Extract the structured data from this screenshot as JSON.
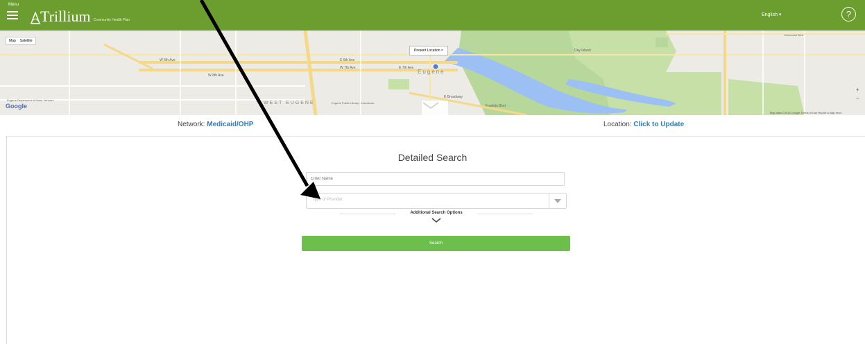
{
  "header": {
    "menu_label": "Menu",
    "logo_word": "Trillium",
    "logo_tagline": "Community Health Plan",
    "language": "English ▾",
    "help_glyph": "?",
    "bar_color": "#6b9e2e"
  },
  "map": {
    "type_map": "Map",
    "type_satellite": "Satellite",
    "info_window": "Present Location  ×",
    "attribution": "Google",
    "terms": "Map data ©2016 Google   Terms of Use   Report a map error",
    "zoom_in": "+",
    "zoom_out": "−",
    "labels": [
      "W 6th Ave",
      "W 7th Ave",
      "W 8th Ave",
      "E 6th Ave",
      "E 7th Ave",
      "E Broadway",
      "WEST EUGENE",
      "Eugene",
      "Franklin Blvd",
      "Day Island",
      "Eugene Public Library - Downtown",
      "Eugene Department of Motor Vehicles",
      "Centennial Blvd"
    ]
  },
  "infobar": {
    "network_label": "Network:",
    "network_value": "Medicaid/OHP",
    "location_label": "Location:",
    "location_value": "Click to Update"
  },
  "search": {
    "title": "Detailed Search",
    "provider_placeholder": "Enter Name",
    "specialty_placeholder": "Type of Provider",
    "additional_label": "Additional Search Options",
    "button_label": "Search",
    "button_color": "#6cbf4a"
  }
}
